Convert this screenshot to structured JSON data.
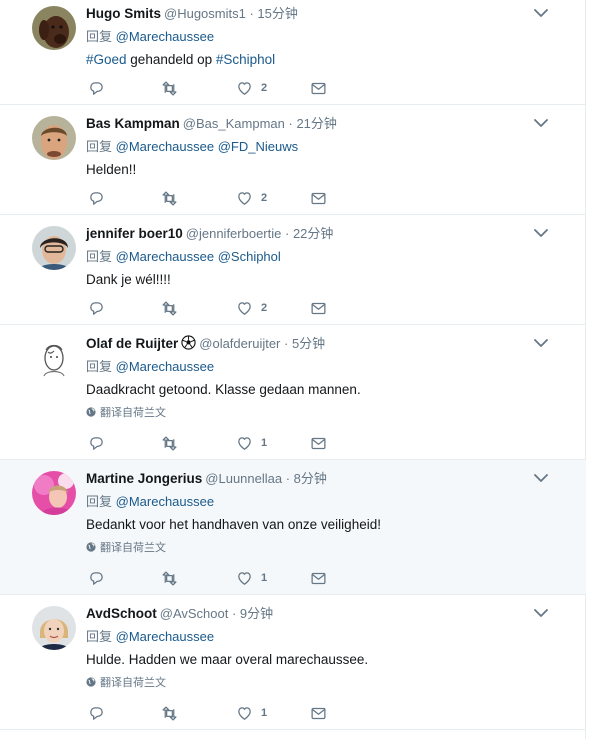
{
  "reply_prefix": "回复",
  "translate_label": "翻译自荷兰文",
  "colors": {
    "link": "#1b5a8c",
    "secondary": "#657786",
    "divider": "#e6ecf0",
    "highlight_bg": "#f5f8fa"
  },
  "tweets": [
    {
      "name": "Hugo Smits",
      "handle": "@Hugosmits1",
      "time": "· 15分钟",
      "mentions": "@Marechaussee",
      "text_parts": [
        "#Goed",
        " gehandeld op ",
        "#Schiphol"
      ],
      "likes": "2"
    },
    {
      "name": "Bas Kampman",
      "handle": "@Bas_Kampman",
      "time": "· 21分钟",
      "mentions": "@Marechaussee @FD_Nieuws",
      "text": "Helden!!",
      "likes": "2"
    },
    {
      "name": "jennifer boer10",
      "handle": "@jenniferboertie",
      "time": "· 22分钟",
      "mentions": "@Marechaussee @Schiphol",
      "text": "Dank je wél!!!!",
      "likes": "2"
    },
    {
      "name": "Olaf de Ruijter",
      "handle": "@olafderuijter",
      "time": "· 5分钟",
      "mentions": "@Marechaussee",
      "text": "Daadkracht getoond. Klasse gedaan mannen.",
      "likes": "1",
      "name_emoji": "soccer-ball-icon"
    },
    {
      "name": "Martine Jongerius",
      "handle": "@Luunnellaa",
      "time": "· 8分钟",
      "mentions": "@Marechaussee",
      "text": "Bedankt voor het handhaven van onze veiligheid!",
      "likes": "1"
    },
    {
      "name": "AvdSchoot",
      "handle": "@AvSchoot",
      "time": "· 9分钟",
      "mentions": "@Marechaussee",
      "text": "Hulde. Hadden we maar overal marechaussee.",
      "likes": "1"
    }
  ]
}
